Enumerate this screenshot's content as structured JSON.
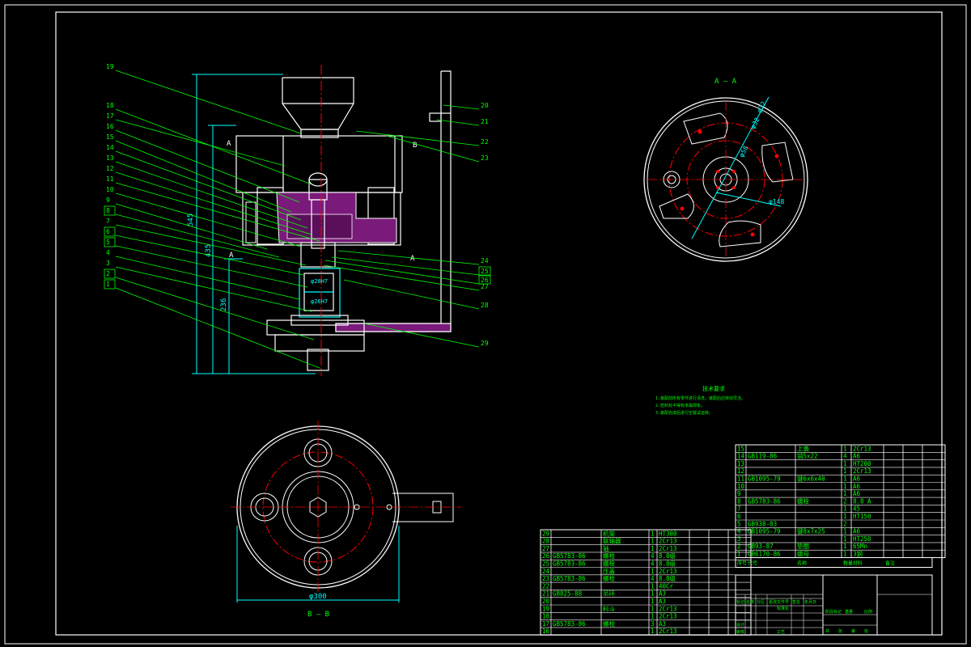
{
  "colors": {
    "background": "#000000",
    "frame": "#ffffff",
    "leader": "#00ff00",
    "center_line": "#ff0000",
    "dimension": "#00ffff",
    "section_hatch": "#ff00ff",
    "table_line": "#ffffff",
    "table_text": "#00ff00"
  },
  "views": {
    "section_aa_title": "A — A",
    "section_bb_title": "B — B",
    "section_marker": "A",
    "section_marker_b": "B"
  },
  "dimensions": {
    "overall_height": "545",
    "height_2": "435",
    "height_3": "236",
    "flange_diameter": "φ300",
    "bolt_circle": "φ148",
    "hole_1": "φ58",
    "hole_2": "φ32",
    "hole_3": "φ32",
    "shaft_dia": "φ32",
    "fit_1": "φ20H7",
    "fit_2": "φ26H7"
  },
  "callouts_left": [
    "19",
    "18",
    "17",
    "16",
    "15",
    "14",
    "13",
    "12",
    "11",
    "10",
    "9",
    "8",
    "7",
    "6",
    "5",
    "4",
    "3",
    "2",
    "1"
  ],
  "callouts_right": [
    "20",
    "21",
    "22",
    "23",
    "24",
    "25",
    "26",
    "27",
    "28",
    "29"
  ],
  "technical_requirements": {
    "title": "技术要求",
    "items": [
      "1.装配前所有零件进行清洗，装配后应转动灵活。",
      "2.密封处不得有渗漏现象。",
      "3.装配完成后进行空载试运转。"
    ]
  },
  "parts_list_right": [
    {
      "no": "15",
      "code": "",
      "name": "上盖",
      "qty": "1",
      "material": "2Cr13"
    },
    {
      "no": "14",
      "code": "GB119-86",
      "name": "销5x22",
      "qty": "4",
      "material": "A6"
    },
    {
      "no": "13",
      "code": "",
      "name": "",
      "qty": "1",
      "material": "HT200"
    },
    {
      "no": "12",
      "code": "",
      "name": "",
      "qty": "1",
      "material": "2Cr13"
    },
    {
      "no": "11",
      "code": "GB1095-79",
      "name": "键6x6x40",
      "qty": "1",
      "material": "A6"
    },
    {
      "no": "10",
      "code": "",
      "name": "",
      "qty": "1",
      "material": "A6"
    },
    {
      "no": "9",
      "code": "",
      "name": "",
      "qty": "1",
      "material": "A6"
    },
    {
      "no": "8",
      "code": "GB5783-86",
      "name": "螺栓",
      "qty": "2",
      "material": "8.8 A"
    },
    {
      "no": "7",
      "code": "",
      "name": "",
      "qty": "1",
      "material": "45"
    },
    {
      "no": "6",
      "code": "",
      "name": "",
      "qty": "1",
      "material": "HT150"
    },
    {
      "no": "5",
      "code": "GB938-83",
      "name": "",
      "qty": "2",
      "material": ""
    },
    {
      "no": "4",
      "code": "GB1095-79",
      "name": "键8x7x25",
      "qty": "1",
      "material": "A6"
    },
    {
      "no": "3",
      "code": "",
      "name": "",
      "qty": "1",
      "material": "HT250"
    },
    {
      "no": "2",
      "code": "GB93-87",
      "name": "垫圈",
      "qty": "1",
      "material": "65Mn"
    },
    {
      "no": "1",
      "code": "GB6170-86",
      "name": "螺母",
      "qty": "1",
      "material": "3钢"
    }
  ],
  "parts_list_right_header": [
    "序号",
    "代号",
    "名称",
    "数量",
    "材料",
    "备注"
  ],
  "parts_list_left": [
    {
      "no": "29",
      "code": "",
      "name": "机架",
      "qty": "1",
      "material": "HT300"
    },
    {
      "no": "28",
      "code": "",
      "name": "联轴器",
      "qty": "1",
      "material": "2Cr13"
    },
    {
      "no": "27",
      "code": "",
      "name": "轴",
      "qty": "1",
      "material": "2Cr13"
    },
    {
      "no": "26",
      "code": "GB5783-86",
      "name": "螺栓",
      "qty": "4",
      "material": "8.8级"
    },
    {
      "no": "25",
      "code": "GB5783-86",
      "name": "螺栓",
      "qty": "4",
      "material": "8.8级"
    },
    {
      "no": "24",
      "code": "",
      "name": "压盖",
      "qty": "1",
      "material": "2Cr13"
    },
    {
      "no": "23",
      "code": "GB5783-86",
      "name": "螺栓",
      "qty": "4",
      "material": "8.8级"
    },
    {
      "no": "22",
      "code": "",
      "name": "",
      "qty": "1",
      "material": "40Cr"
    },
    {
      "no": "21",
      "code": "GB825-88",
      "name": "吊环",
      "qty": "1",
      "material": "A3"
    },
    {
      "no": "20",
      "code": "",
      "name": "",
      "qty": "1",
      "material": "A3"
    },
    {
      "no": "19",
      "code": "",
      "name": "料斗",
      "qty": "1",
      "material": "2Cr13"
    },
    {
      "no": "18",
      "code": "",
      "name": "",
      "qty": "1",
      "material": "2Cr13"
    },
    {
      "no": "17",
      "code": "GB5783-86",
      "name": "螺栓",
      "qty": "3",
      "material": "A3"
    },
    {
      "no": "16",
      "code": "",
      "name": "",
      "qty": "1",
      "material": "2Cr13"
    }
  ],
  "title_block": {
    "labels": [
      "标记",
      "处数",
      "分区",
      "更改文件号",
      "签名",
      "年月日"
    ],
    "design": "设计",
    "standardize": "标准化",
    "review": "审核",
    "process": "工艺",
    "approve": "批准",
    "stage_labels": [
      "阶段标记",
      "重量",
      "比例"
    ],
    "sheet": [
      "共",
      "张",
      "第",
      "张"
    ]
  }
}
